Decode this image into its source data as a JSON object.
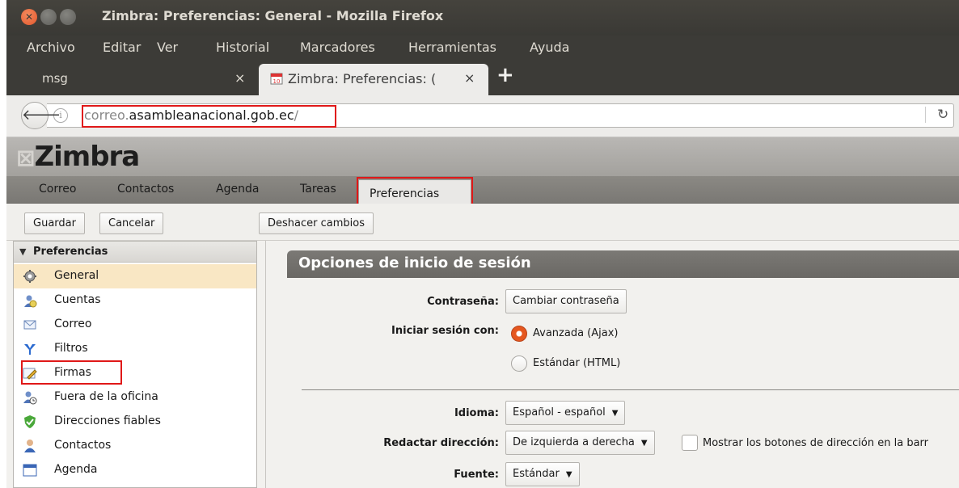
{
  "window": {
    "title": "Zimbra: Preferencias: General - Mozilla Firefox"
  },
  "menubar": {
    "items": [
      "Archivo",
      "Editar",
      "Ver",
      "Historial",
      "Marcadores",
      "Herramientas",
      "Ayuda"
    ]
  },
  "browser_tabs": {
    "tab1_label": "msg",
    "tab2_label": "Zimbra: Preferencias: (",
    "close_glyph": "×",
    "new_tab_glyph": "+"
  },
  "url": {
    "prefix": "correo.",
    "domain": "asambleanacional.gob.ec",
    "suffix": "/"
  },
  "zimbra": {
    "logo": "Zimbra",
    "tabs": [
      "Correo",
      "Contactos",
      "Agenda",
      "Tareas",
      "Preferencias"
    ],
    "active_tab": "Preferencias"
  },
  "toolbar": {
    "save": "Guardar",
    "cancel": "Cancelar",
    "undo": "Deshacer cambios"
  },
  "sidebar": {
    "title": "Preferencias",
    "items": [
      {
        "label": "General",
        "icon": "gear-icon",
        "selected": true
      },
      {
        "label": "Cuentas",
        "icon": "accounts-icon",
        "selected": false
      },
      {
        "label": "Correo",
        "icon": "mail-icon",
        "selected": false
      },
      {
        "label": "Filtros",
        "icon": "filter-icon",
        "selected": false
      },
      {
        "label": "Firmas",
        "icon": "signature-icon",
        "selected": false
      },
      {
        "label": "Fuera de la oficina",
        "icon": "out-of-office-icon",
        "selected": false
      },
      {
        "label": "Direcciones fiables",
        "icon": "shield-icon",
        "selected": false
      },
      {
        "label": "Contactos",
        "icon": "contact-icon",
        "selected": false
      },
      {
        "label": "Agenda",
        "icon": "calendar-icon",
        "selected": false
      }
    ]
  },
  "section": {
    "title": "Opciones de inicio de sesión",
    "password_label": "Contraseña:",
    "password_button": "Cambiar contraseña",
    "login_label": "Iniciar sesión con:",
    "login_options": [
      {
        "label": "Avanzada (Ajax)",
        "checked": true
      },
      {
        "label": "Estándar (HTML)",
        "checked": false
      }
    ],
    "language_label": "Idioma:",
    "language_value": "Español - español",
    "direction_label": "Redactar dirección:",
    "direction_value": "De izquierda a derecha",
    "direction_checkbox_label": "Mostrar los botones de dirección en la barr",
    "font_label": "Fuente:",
    "font_value": "Estándar"
  },
  "colors": {
    "highlight": "#e01818",
    "selected_row": "#f9e7c4",
    "radio_on": "#e5571f",
    "titlebar": "#3c3b37"
  }
}
